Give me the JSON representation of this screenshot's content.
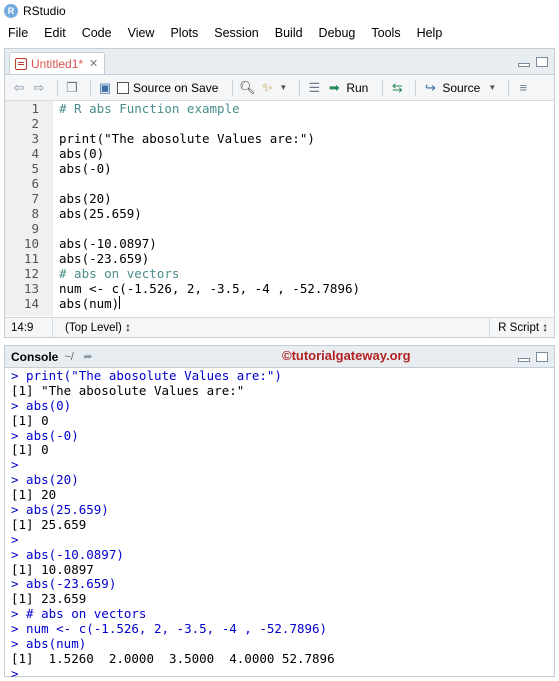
{
  "window": {
    "title": "RStudio",
    "logo": "R"
  },
  "menu": [
    "File",
    "Edit",
    "Code",
    "View",
    "Plots",
    "Session",
    "Build",
    "Debug",
    "Tools",
    "Help"
  ],
  "source": {
    "tab_label": "Untitled1*",
    "toolbar": {
      "source_on_save": "Source on Save",
      "run": "Run",
      "source": "Source"
    },
    "lines": [
      {
        "n": "1",
        "text": "# R abs Function example"
      },
      {
        "n": "2",
        "text": ""
      },
      {
        "n": "3",
        "text": "print(\"The abosolute Values are:\")"
      },
      {
        "n": "4",
        "text": "abs(0)"
      },
      {
        "n": "5",
        "text": "abs(-0)"
      },
      {
        "n": "6",
        "text": ""
      },
      {
        "n": "7",
        "text": "abs(20)"
      },
      {
        "n": "8",
        "text": "abs(25.659)"
      },
      {
        "n": "9",
        "text": ""
      },
      {
        "n": "10",
        "text": "abs(-10.0897)"
      },
      {
        "n": "11",
        "text": "abs(-23.659)"
      },
      {
        "n": "12",
        "text": "# abs on vectors"
      },
      {
        "n": "13",
        "text": "num <- c(-1.526, 2, -3.5, -4 , -52.7896)"
      },
      {
        "n": "14",
        "text": "abs(num)"
      }
    ],
    "status": {
      "position": "14:9",
      "scope": "(Top Level) ↕",
      "filetype": "R Script ↕"
    }
  },
  "console": {
    "title": "Console",
    "path": "~/",
    "watermark": "©tutorialgateway.org",
    "lines": [
      {
        "kind": "in",
        "text": "> print(\"The abosolute Values are:\")"
      },
      {
        "kind": "out",
        "text": "[1] \"The abosolute Values are:\""
      },
      {
        "kind": "in",
        "text": "> abs(0)"
      },
      {
        "kind": "out",
        "text": "[1] 0"
      },
      {
        "kind": "in",
        "text": "> abs(-0)"
      },
      {
        "kind": "out",
        "text": "[1] 0"
      },
      {
        "kind": "in",
        "text": ">"
      },
      {
        "kind": "in",
        "text": "> abs(20)"
      },
      {
        "kind": "out",
        "text": "[1] 20"
      },
      {
        "kind": "in",
        "text": "> abs(25.659)"
      },
      {
        "kind": "out",
        "text": "[1] 25.659"
      },
      {
        "kind": "in",
        "text": ">"
      },
      {
        "kind": "in",
        "text": "> abs(-10.0897)"
      },
      {
        "kind": "out",
        "text": "[1] 10.0897"
      },
      {
        "kind": "in",
        "text": "> abs(-23.659)"
      },
      {
        "kind": "out",
        "text": "[1] 23.659"
      },
      {
        "kind": "in",
        "text": "> # abs on vectors"
      },
      {
        "kind": "in",
        "text": "> num <- c(-1.526, 2, -3.5, -4 , -52.7896)"
      },
      {
        "kind": "in",
        "text": "> abs(num)"
      },
      {
        "kind": "out",
        "text": "[1]  1.5260  2.0000  3.5000  4.0000 52.7896"
      },
      {
        "kind": "in",
        "text": ">"
      }
    ]
  },
  "colors": {
    "console_input": "#0000cd",
    "comment": "#4a8c8c",
    "string": "#036a07",
    "number": "#0000cd",
    "watermark": "#b22222",
    "tab_modified": "#d9534f"
  }
}
